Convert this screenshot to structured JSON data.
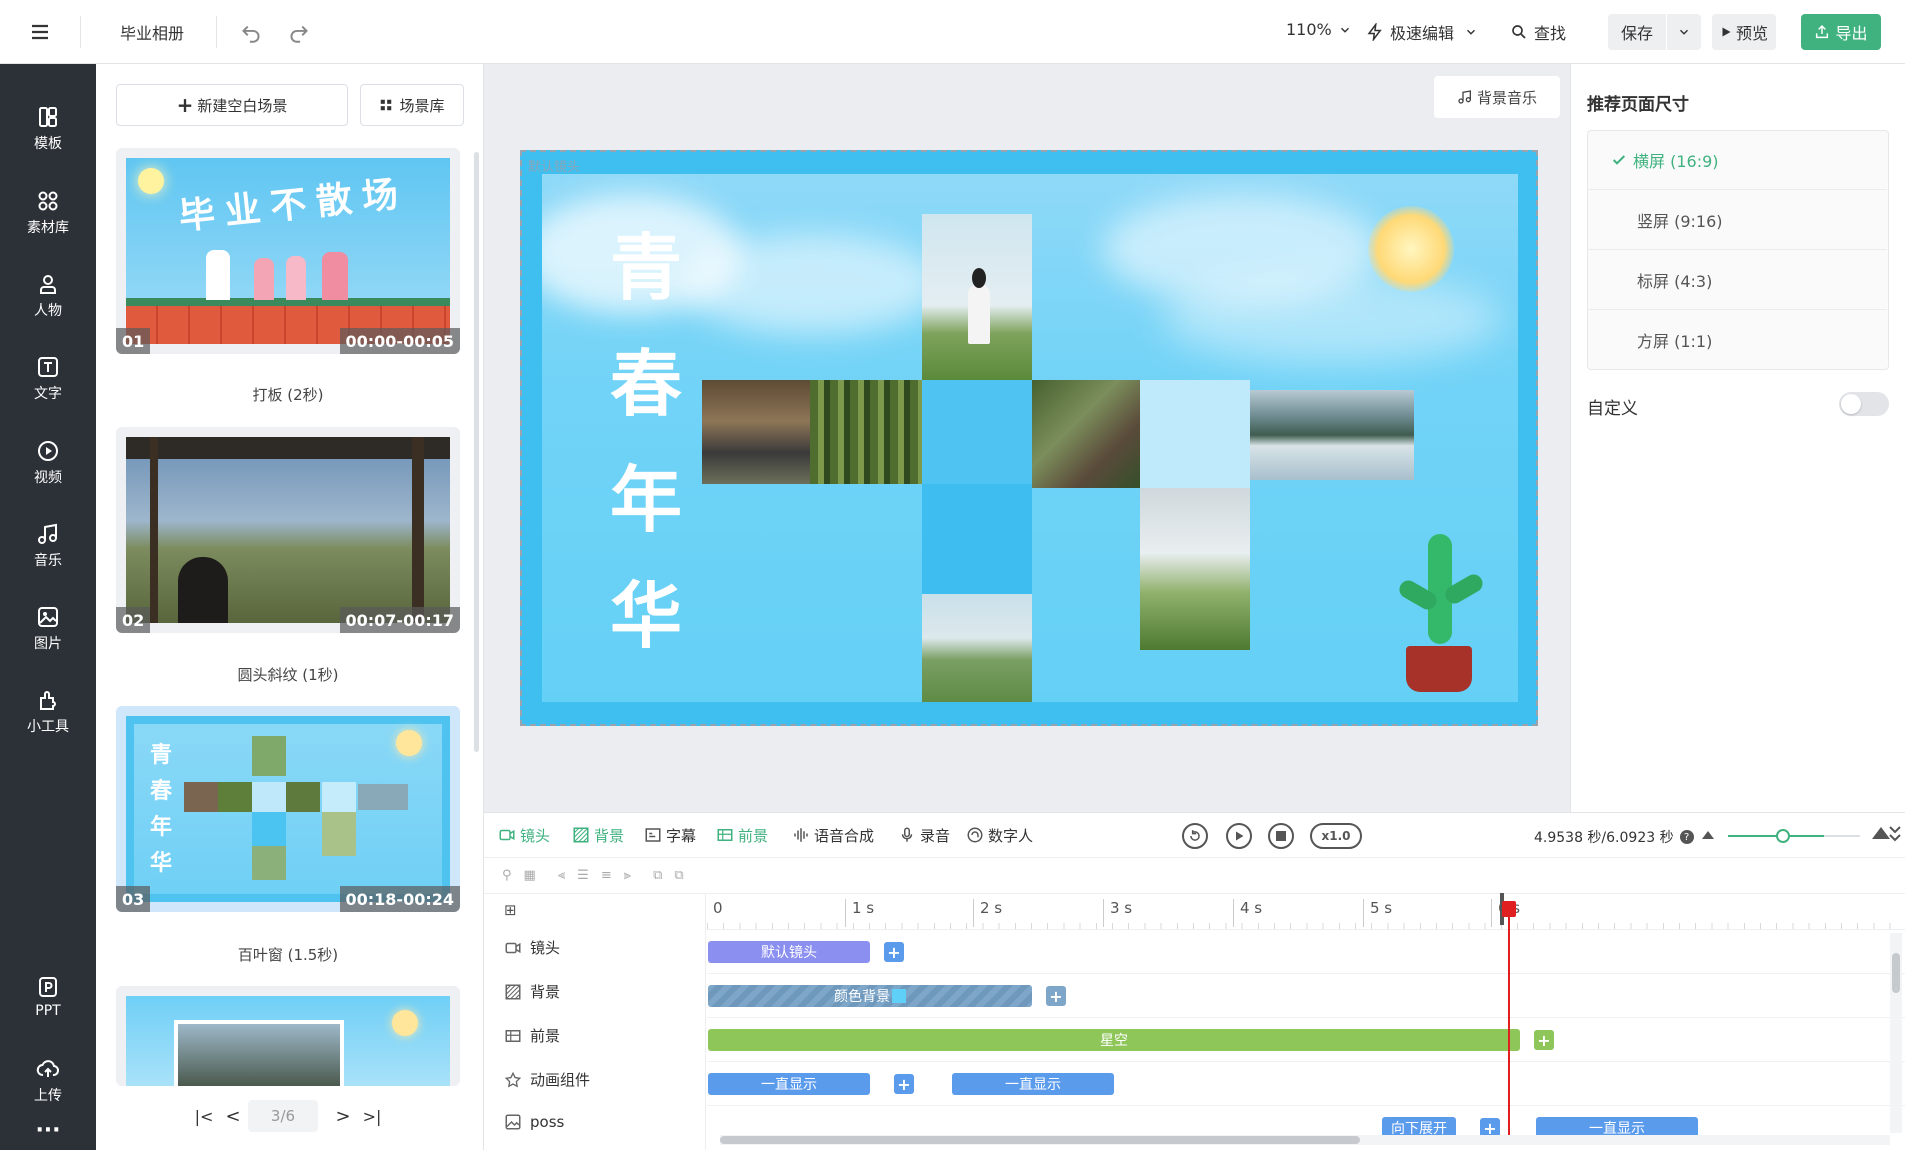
{
  "topbar": {
    "project_title": "毕业相册",
    "zoom": "110%",
    "edit_mode": "极速编辑",
    "search": "查找",
    "save": "保存",
    "preview": "预览",
    "export": "导出"
  },
  "leftnav": {
    "items": [
      {
        "label": "模板",
        "icon": "template-icon"
      },
      {
        "label": "素材库",
        "icon": "material-icon"
      },
      {
        "label": "人物",
        "icon": "person-icon"
      },
      {
        "label": "文字",
        "icon": "text-icon"
      },
      {
        "label": "视频",
        "icon": "video-icon"
      },
      {
        "label": "音乐",
        "icon": "music-icon"
      },
      {
        "label": "图片",
        "icon": "image-icon"
      },
      {
        "label": "小工具",
        "icon": "tools-icon"
      }
    ],
    "bottom": [
      {
        "label": "PPT",
        "icon": "ppt-icon"
      },
      {
        "label": "上传",
        "icon": "upload-icon"
      }
    ],
    "more": "···"
  },
  "scenes": {
    "new_blank": "新建空白场景",
    "library": "场景库",
    "cards": [
      {
        "num": "01",
        "time": "00:00-00:05",
        "label": "打板 (2秒)",
        "thumb_title": "毕业不散场"
      },
      {
        "num": "02",
        "time": "00:07-00:17",
        "label": "圆头斜纹 (1秒)"
      },
      {
        "num": "03",
        "time": "00:18-00:24",
        "label": "百叶窗 (1.5秒)",
        "thumb_title": [
          "青",
          "春",
          "年",
          "华"
        ]
      }
    ],
    "pager": "3/6"
  },
  "canvas": {
    "bg_music": "背景音乐",
    "lens_label": "默认镜头",
    "title_chars": [
      "青",
      "春",
      "年",
      "华"
    ]
  },
  "right": {
    "title": "推荐页面尺寸",
    "options": [
      "横屏 (16:9)",
      "竖屏 (9:16)",
      "标屏 (4:3)",
      "方屏 (1:1)"
    ],
    "custom": "自定义"
  },
  "timeline": {
    "tabs": [
      "镜头",
      "背景",
      "字幕",
      "前景",
      "语音合成",
      "录音",
      "数字人"
    ],
    "speed": "x1.0",
    "time_readout": "4.9538 秒/6.0923 秒",
    "ruler": [
      "0",
      "1 s",
      "2 s",
      "3 s",
      "4 s",
      "5 s",
      "6 s"
    ],
    "rows": [
      {
        "label": "镜头",
        "clips": [
          "默认镜头"
        ]
      },
      {
        "label": "背景",
        "clips": [
          "颜色背景"
        ]
      },
      {
        "label": "前景",
        "clips": [
          "星空"
        ]
      },
      {
        "label": "动画组件",
        "clips": [
          "一直显示",
          "一直显示"
        ]
      },
      {
        "label": "poss",
        "clips": [
          "向下展开",
          "一直显示"
        ]
      }
    ]
  },
  "colors": {
    "accent_green": "#3fb27f",
    "sky": "#5fd0f7",
    "clip_blue": "#5b9bec",
    "clip_purple": "#8b8ff0",
    "clip_green": "#8fc65a",
    "playhead": "#e02020"
  }
}
